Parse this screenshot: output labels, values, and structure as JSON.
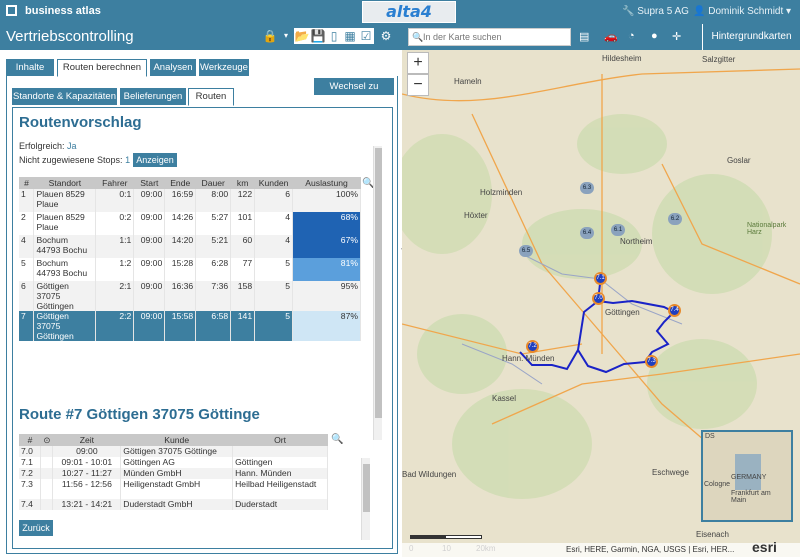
{
  "top": {
    "brand": "business atlas",
    "logo_a": "alta",
    "logo_b": "4",
    "license": "Supra 5 AG",
    "user": "Dominik Schmidt"
  },
  "panel": {
    "title": "Vertriebscontrolling",
    "tabs": [
      "Inhalte",
      "Routen berechnen",
      "Analysen",
      "Werkzeuge"
    ],
    "subtabs": [
      "Standorte & Kapazitäten",
      "Belieferungen",
      "Routen"
    ],
    "switch_label": "Wechsel zu Simple"
  },
  "vorschlag": {
    "heading": "Routenvorschlag",
    "success_label": "Erfolgreich:",
    "success_value": "Ja",
    "unassigned_label": "Nicht zugewiesene Stops:",
    "unassigned_value": "1",
    "show_btn": "Anzeigen",
    "columns": [
      "#",
      "Standort",
      "Fahrer",
      "Start",
      "Ende",
      "Dauer",
      "km",
      "Kunden",
      "Auslastung"
    ],
    "rows": [
      {
        "n": "1",
        "standort": "Plauen 8529 Plaue",
        "fahrer": "0:1",
        "start": "09:00",
        "ende": "16:59",
        "dauer": "8:00",
        "km": "122",
        "kunden": "6",
        "aus": "100%",
        "fill": 1.0
      },
      {
        "n": "2",
        "standort": "Plauen 8529 Plaue",
        "fahrer": "0:2",
        "start": "09:00",
        "ende": "14:26",
        "dauer": "5:27",
        "km": "101",
        "kunden": "4",
        "aus": "68%",
        "fill": 0.68,
        "color": "#1f63b3"
      },
      {
        "n": "4",
        "standort": "Bochum 44793 Bochu",
        "fahrer": "1:1",
        "start": "09:00",
        "ende": "14:20",
        "dauer": "5:21",
        "km": "60",
        "kunden": "4",
        "aus": "67%",
        "fill": 0.67,
        "color": "#1f63b3"
      },
      {
        "n": "5",
        "standort": "Bochum 44793 Bochu",
        "fahrer": "1:2",
        "start": "09:00",
        "ende": "15:28",
        "dauer": "6:28",
        "km": "77",
        "kunden": "5",
        "aus": "81%",
        "fill": 0.81,
        "color": "#5b9fdc"
      },
      {
        "n": "6",
        "standort": "Göttigen 37075 Göttingen",
        "fahrer": "2:1",
        "start": "09:00",
        "ende": "16:36",
        "dauer": "7:36",
        "km": "158",
        "kunden": "5",
        "aus": "95%",
        "fill": 0.95
      },
      {
        "n": "7",
        "standort": "Göttigen 37075 Göttingen",
        "fahrer": "2:2",
        "start": "09:00",
        "ende": "15:58",
        "dauer": "6:58",
        "km": "141",
        "kunden": "5",
        "aus": "87%",
        "fill": 0.87,
        "selected": true
      }
    ]
  },
  "route": {
    "heading": "Route #7 Göttigen 37075 Göttinge",
    "columns": [
      "#",
      "⊙",
      "Zeit",
      "Kunde",
      "Ort"
    ],
    "rows": [
      {
        "n": "7.0",
        "zeit": "09:00",
        "kunde": "Göttigen 37075 Göttinge",
        "ort": ""
      },
      {
        "n": "7.1",
        "zeit": "09:01 - 10:01",
        "kunde": "Göttingen AG",
        "ort": "Göttingen"
      },
      {
        "n": "7.2",
        "zeit": "10:27 - 11:27",
        "kunde": "Münden GmbH",
        "ort": "Hann. Münden"
      },
      {
        "n": "7.3",
        "zeit": "11:56 - 12:56",
        "kunde": "Heiligenstadt GmbH",
        "ort": "Heilbad Heiligenstadt"
      },
      {
        "n": "7.4",
        "zeit": "13:21 - 14:21",
        "kunde": "Duderstadt GmbH",
        "ort": "Duderstadt"
      }
    ],
    "back": "Zurück"
  },
  "map": {
    "search_placeholder": "In der Karte suchen",
    "basemap_btn": "Hintergrundkarten",
    "attribution": "Esri, HERE, Garmin, NGA, USGS | Esri, HER...",
    "scale": [
      "0",
      "10",
      "20km"
    ],
    "cities": [
      "Hameln",
      "Hildesheim",
      "Salzgitter",
      "Goslar",
      "Holzminden",
      "Höxter",
      "Northeim",
      "Nationalpark Harz",
      "Göttingen",
      "Hann. Münden",
      "Kassel",
      "Bad Wildungen",
      "Eschwege",
      "Eisenach"
    ],
    "badges": [
      "6.3",
      "6.2",
      "6.4",
      "6.1",
      "6.5"
    ],
    "pins": [
      "7.0",
      "7.1",
      "7.2",
      "7.3",
      "7.4"
    ],
    "overview": [
      "DS",
      "GERMANY",
      "Cologne",
      "Frankfurt am Main"
    ]
  }
}
